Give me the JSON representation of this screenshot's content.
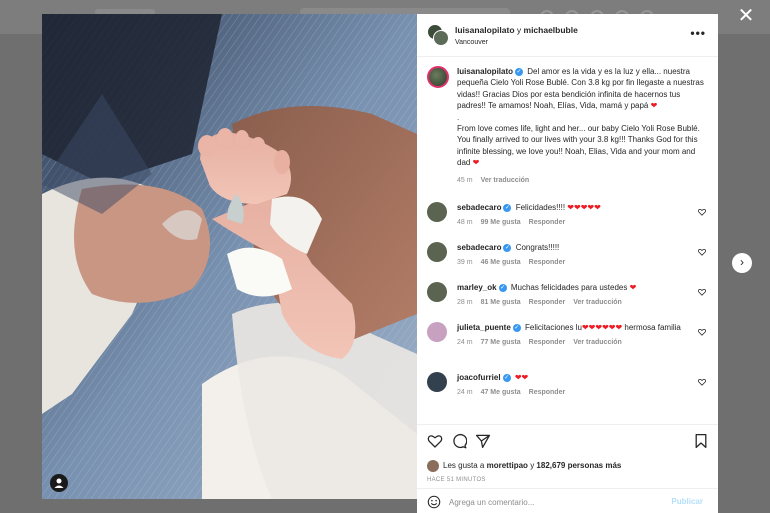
{
  "post": {
    "header_user_1": "luisanalopilato",
    "header_joiner": "y",
    "header_user_2": "michaelbuble",
    "location": "Vancouver",
    "more_glyph": "•••"
  },
  "caption": {
    "username": "luisanalopilato",
    "text_es": "Del amor es la vida y es la luz y ella... nuestra pequeña Cielo Yoli Rose Bublé. Con 3.8 kg por fin llegaste a nuestras vidas!! Gracias Dios por esta bendición infinita de hacernos tus padres!! Te amamos! Noah, Elías, Vida, mamá y papá",
    "dot": ".",
    "text_en": "From love comes life, light and her... our baby Cielo Yoli Rose Bublé. You finally arrived to our lives with your 3.8 kg!!! Thanks God for this infinite blessing, we love you!! Noah, Elias, Vida and your mom and dad",
    "time": "45 m",
    "translate": "Ver traducción"
  },
  "comments": [
    {
      "user": "sebadecaro",
      "text": "Felicidades!!!!",
      "hearts": "❤❤❤❤❤",
      "text_after": "",
      "time": "48 m",
      "likes": "99 Me gusta",
      "reply": "Responder",
      "translate": ""
    },
    {
      "user": "sebadecaro",
      "text": "Congrats!!!!!",
      "hearts": "",
      "text_after": "",
      "time": "39 m",
      "likes": "46 Me gusta",
      "reply": "Responder",
      "translate": ""
    },
    {
      "user": "marley_ok",
      "text": "Muchas felicidades para ustedes",
      "hearts": "❤",
      "text_after": "",
      "time": "28 m",
      "likes": "81 Me gusta",
      "reply": "Responder",
      "translate": "Ver traducción"
    },
    {
      "user": "julieta_puente",
      "text": "Felicitaciones lu",
      "hearts": "❤❤❤❤❤❤",
      "text_after": "hermosa familia",
      "time": "24 m",
      "likes": "77 Me gusta",
      "reply": "Responder",
      "translate": "Ver traducción"
    },
    {
      "user": "joacofurriel",
      "text": "",
      "hearts": "❤❤",
      "text_after": "",
      "time": "24 m",
      "likes": "47 Me gusta",
      "reply": "Responder",
      "translate": ""
    }
  ],
  "likes": {
    "prefix": "Les gusta a",
    "user": "morettipao",
    "joiner": "y",
    "count": "182,679 personas más"
  },
  "time_ago": "HACE 51 MINUTOS",
  "comment_box": {
    "placeholder": "Agrega un comentario...",
    "publish": "Publicar"
  },
  "icons": {
    "close": "close-icon",
    "next": "chevron-right-icon",
    "heart": "heart-icon",
    "comment": "comment-icon",
    "share": "share-icon",
    "save": "bookmark-icon",
    "emoji": "emoji-icon",
    "verified": "verified-badge-icon",
    "user_tag": "user-tag-icon"
  },
  "colors": {
    "verified": "#3897f0",
    "heart": "#ed1c24",
    "publish_disabled": "#b2dffc",
    "overlay": "#6f6f6f"
  },
  "glyphs": {
    "close": "✕",
    "next": "›",
    "verified": "✓"
  }
}
